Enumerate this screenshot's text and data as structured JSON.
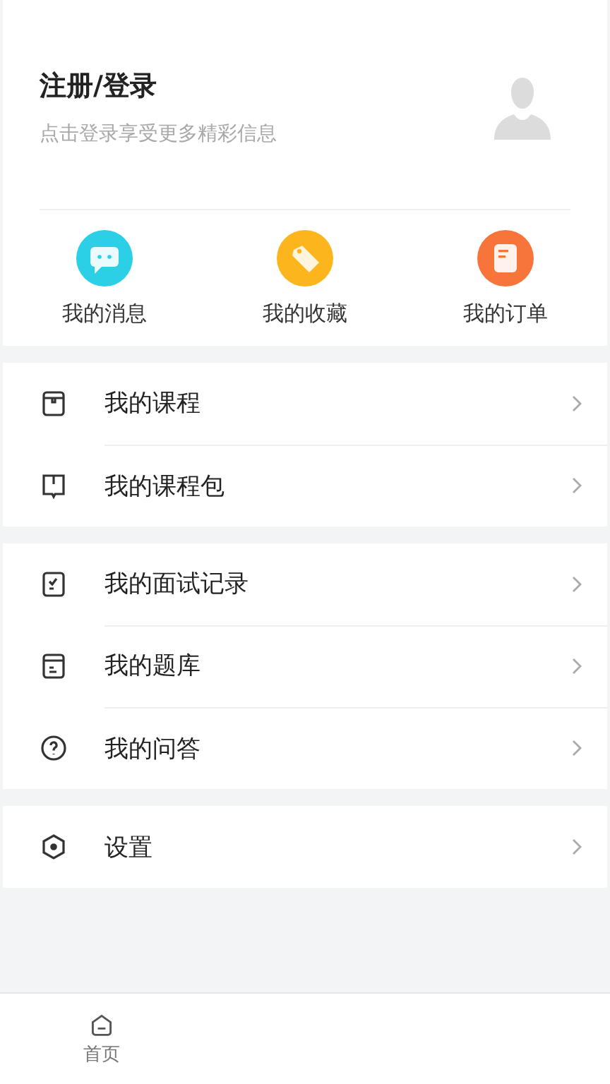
{
  "profile": {
    "title": "注册/登录",
    "subtitle": "点击登录享受更多精彩信息"
  },
  "shortcuts": [
    {
      "label": "我的消息",
      "kind": "message",
      "color": "#2bd0e6"
    },
    {
      "label": "我的收藏",
      "kind": "tag",
      "color": "#fdb51d"
    },
    {
      "label": "我的订单",
      "kind": "order",
      "color": "#f7743a"
    }
  ],
  "menu_groups": [
    {
      "items": [
        {
          "label": "我的课程",
          "kind": "box"
        },
        {
          "label": "我的课程包",
          "kind": "book"
        }
      ]
    },
    {
      "items": [
        {
          "label": "我的面试记录",
          "kind": "check"
        },
        {
          "label": "我的题库",
          "kind": "bank"
        },
        {
          "label": "我的问答",
          "kind": "question"
        }
      ]
    },
    {
      "items": [
        {
          "label": "设置",
          "kind": "hexagon"
        }
      ]
    }
  ],
  "tab_bar": [
    {
      "label": "首页",
      "kind": "home"
    }
  ]
}
